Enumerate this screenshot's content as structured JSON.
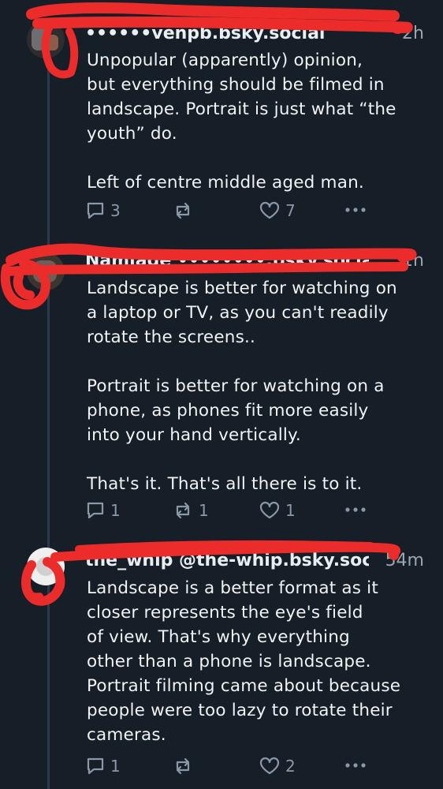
{
  "posts": [
    {
      "handle": "••••••venpb.bsky.social",
      "time": "2h",
      "text": "Unpopular (apparently) opinion,\nbut everything should be filmed in\nlandscape. Portrait is just what “the\nyouth” do.\n\nLeft of centre middle aged man.",
      "replies": "3",
      "reposts": "",
      "likes": "7"
    },
    {
      "handle": "Namiade ••••••••.bsky.social",
      "time": "1h",
      "text": "Landscape is better for watching on\na laptop or TV, as you can't readily\nrotate the screens..\n\nPortrait is better for watching on a\nphone, as phones fit more easily\ninto your hand vertically.\n\nThat's it. That's all there is to it.",
      "replies": "1",
      "reposts": "1",
      "likes": "1"
    },
    {
      "handle": "the_whip @the-whip.bsky.social",
      "time": "54m",
      "text": "Landscape is a better format as it\ncloser represents the eye's field\nof view. That's why everything\nother than a phone is landscape.\nPortrait filming came about because\npeople were too lazy to rotate their\ncameras.",
      "replies": "1",
      "reposts": "",
      "likes": "2"
    }
  ],
  "icons": {
    "reply": "reply-icon",
    "repost": "repost-icon",
    "like": "heart-icon",
    "more": "more-icon"
  },
  "colors": {
    "background": "#161e27",
    "text": "#f1f3f5",
    "muted": "#8b98a8",
    "redaction": "#ec2b2b"
  }
}
